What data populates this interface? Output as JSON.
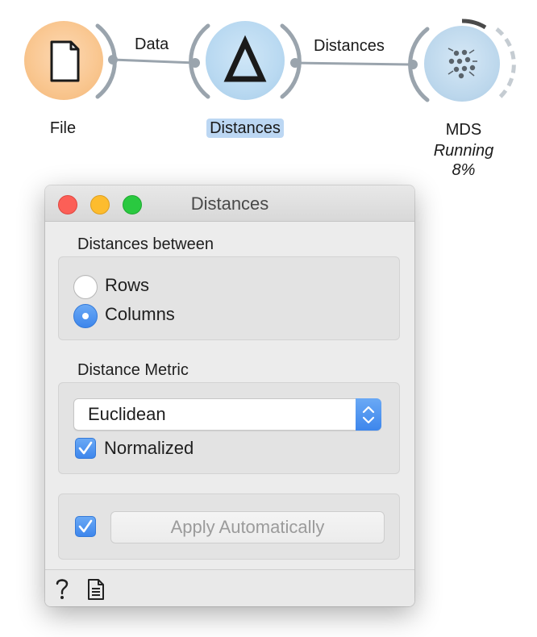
{
  "workflow": {
    "nodes": [
      {
        "label": "File",
        "icon": "file-icon",
        "color": "#f9c68f"
      },
      {
        "label": "Distances",
        "icon": "delta-icon",
        "color": "#b9d9f1",
        "selected": true
      },
      {
        "label": "MDS",
        "icon": "mds-scatter-icon",
        "color": "#bcd7ec",
        "status_line1": "Running",
        "status_line2": "8%",
        "progress": 0.08
      }
    ],
    "links": [
      {
        "label": "Data"
      },
      {
        "label": "Distances"
      }
    ]
  },
  "window": {
    "title": "Distances",
    "distances_between": {
      "title": "Distances between",
      "options": [
        "Rows",
        "Columns"
      ],
      "selected": "Columns"
    },
    "distance_metric": {
      "title": "Distance Metric",
      "selected": "Euclidean",
      "normalized_label": "Normalized",
      "normalized_checked": true
    },
    "apply": {
      "auto_checked": true,
      "label": "Apply Automatically"
    },
    "footer": {
      "help_icon": "question-icon",
      "report_icon": "report-icon"
    },
    "accent_color": "#3d86ec"
  }
}
